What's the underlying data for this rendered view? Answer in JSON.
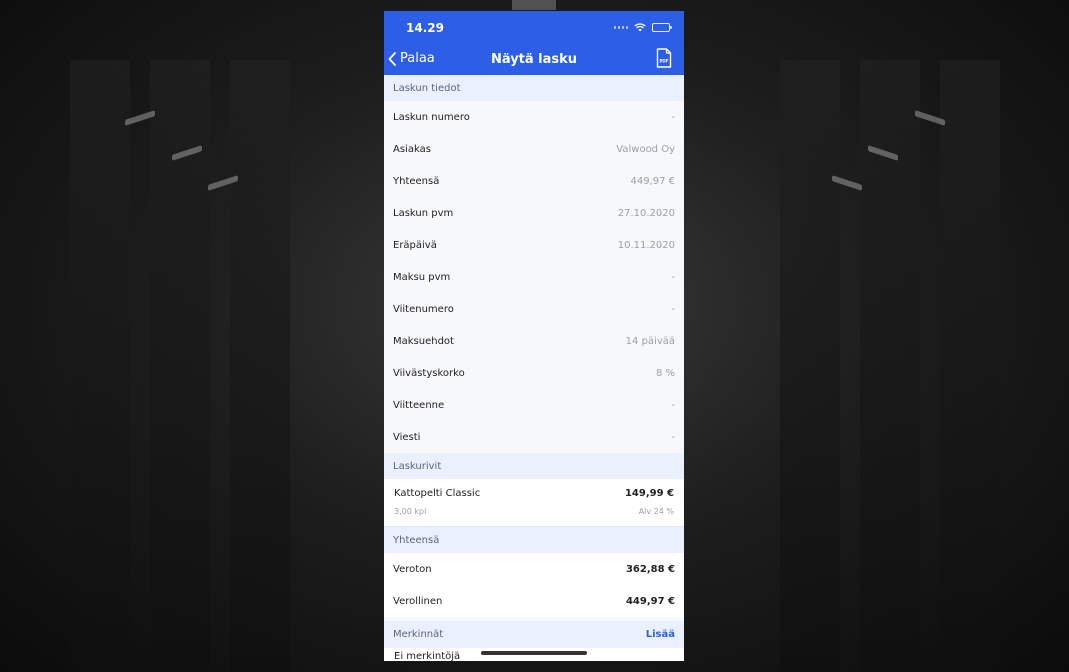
{
  "status_bar": {
    "time": "14.29"
  },
  "nav": {
    "back_label": "Palaa",
    "title": "Näytä lasku",
    "pdf_label": "PDF"
  },
  "sections": {
    "invoice_info": "Laskun tiedot",
    "invoice_rows": "Laskurivit",
    "totals": "Yhteensä",
    "notes": "Merkinnät",
    "notes_action": "Lisää"
  },
  "invoice_fields": [
    {
      "label": "Laskun numero",
      "value": "-"
    },
    {
      "label": "Asiakas",
      "value": "Valwood Oy"
    },
    {
      "label": "Yhteensä",
      "value": "449,97 €"
    },
    {
      "label": "Laskun pvm",
      "value": "27.10.2020"
    },
    {
      "label": "Eräpäivä",
      "value": "10.11.2020"
    },
    {
      "label": "Maksu pvm",
      "value": "-"
    },
    {
      "label": "Viitenumero",
      "value": "-"
    },
    {
      "label": "Maksuehdot",
      "value": "14 päivää"
    },
    {
      "label": "Viivästyskorko",
      "value": "8 %"
    },
    {
      "label": "Viitteenne",
      "value": "-"
    },
    {
      "label": "Viesti",
      "value": "-"
    }
  ],
  "invoice_rows": [
    {
      "name": "Kattopelti Classic",
      "price": "149,99 €",
      "quantity": "3,00 kpl",
      "vat": "Alv 24 %"
    }
  ],
  "totals": [
    {
      "label": "Veroton",
      "value": "362,88 €"
    },
    {
      "label": "Verollinen",
      "value": "449,97 €"
    }
  ],
  "notes_partial_text": "Ei merkintöjä"
}
